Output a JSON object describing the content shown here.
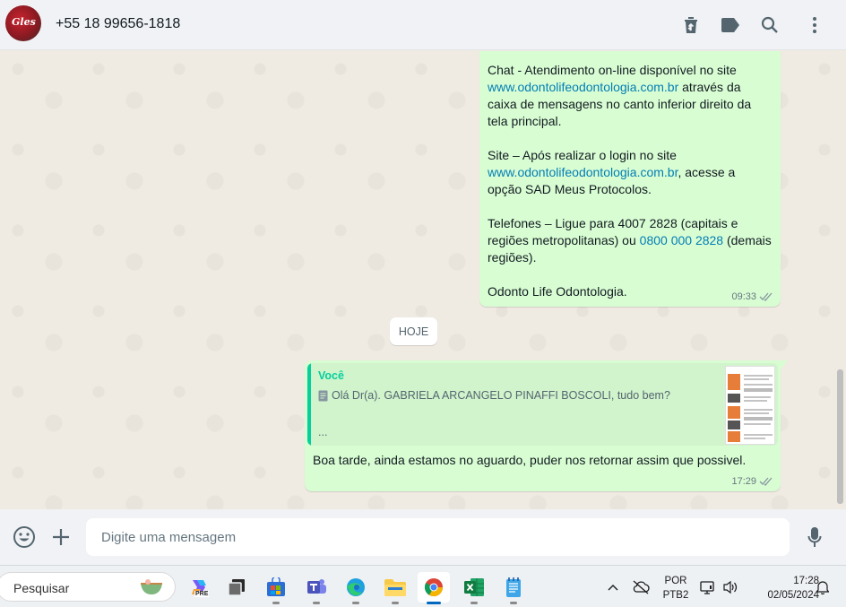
{
  "header": {
    "contact_name": "+55 18 99656-1818",
    "avatar_text": "Gles",
    "icons": [
      "delete-icon",
      "label-icon",
      "search-icon",
      "menu-icon"
    ]
  },
  "chat": {
    "message1": {
      "p1_text1": "Chat - Atendimento on-line disponível no site ",
      "p1_link": "www.odontolifeodontologia.com.br",
      "p1_text2": " através da caixa de mensagens no canto inferior direito da tela principal.",
      "p2_text1": "Site – Após realizar o login no site ",
      "p2_link": "www.odontolifeodontologia.com.br",
      "p2_text2": ", acesse a opção SAD Meus Protocolos.",
      "p3_text1": "Telefones – Ligue para 4007 2828 (capitais e regiões metropolitanas) ou ",
      "p3_link": "0800 000 2828",
      "p3_text2": " (demais regiões).",
      "p4_text": "Odonto Life Odontologia.",
      "time": "09:33"
    },
    "day_badge": "HOJE",
    "message2": {
      "quote_author": "Você",
      "quote_text": "Olá Dr(a). GABRIELA ARCANGELO PINAFFI BOSCOLI, tudo bem?",
      "quote_more": "...",
      "text": "Boa tarde, ainda estamos no aguardo, puder nos retornar assim que possivel.",
      "time": "17:29"
    }
  },
  "composer": {
    "placeholder": "Digite uma mensagem"
  },
  "taskbar": {
    "search_label": "Pesquisar",
    "lang_line1": "POR",
    "lang_line2": "PTB2",
    "time": "17:28",
    "date": "02/05/2024",
    "copilot_badge": "PRE"
  },
  "colors": {
    "bubble_out": "#d9fdd3",
    "accent": "#06cf9c",
    "link": "#027eb5",
    "header_bg": "#f0f2f5"
  }
}
